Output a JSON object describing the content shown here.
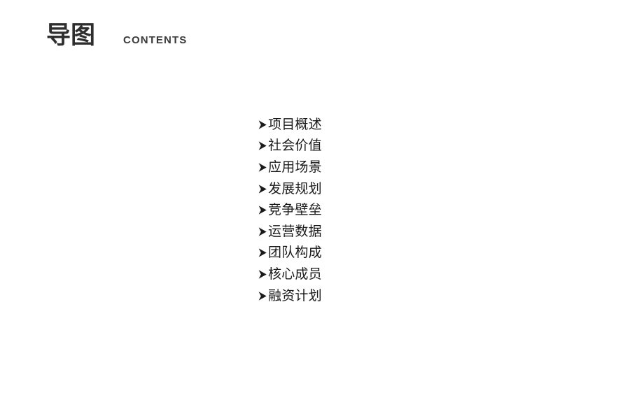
{
  "slide": {
    "background_color": "#ffffff",
    "header": {
      "title": "导图",
      "subtitle": "CONTENTS",
      "title_color": "#2e2e2e",
      "subtitle_color": "#3a3a3a"
    },
    "contents": {
      "bullet_icon": "chevron-right-triangle-icon",
      "text_color": "#1a1a1a",
      "items": [
        {
          "label": "项目概述"
        },
        {
          "label": "社会价值"
        },
        {
          "label": "应用场景"
        },
        {
          "label": "发展规划"
        },
        {
          "label": "竞争壁垒"
        },
        {
          "label": "运营数据"
        },
        {
          "label": "团队构成"
        },
        {
          "label": "核心成员"
        },
        {
          "label": "融资计划"
        }
      ]
    }
  }
}
